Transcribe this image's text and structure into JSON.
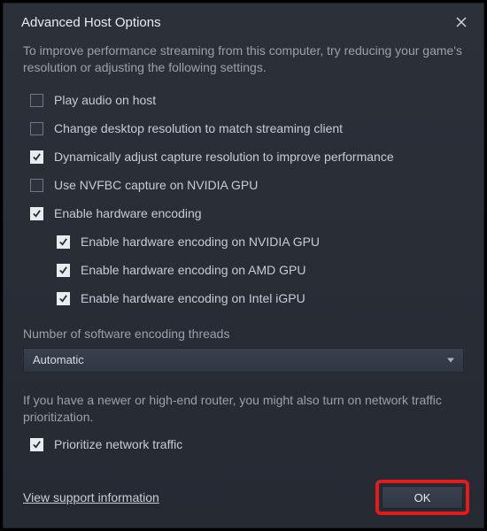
{
  "window": {
    "title": "Advanced Host Options"
  },
  "intro": "To improve performance streaming from this computer, try reducing your game's resolution or adjusting the following settings.",
  "options": {
    "play_audio": {
      "label": "Play audio on host",
      "checked": false
    },
    "change_resolution": {
      "label": "Change desktop resolution to match streaming client",
      "checked": false
    },
    "dynamic_capture": {
      "label": "Dynamically adjust capture resolution to improve performance",
      "checked": true
    },
    "nvfbc": {
      "label": "Use NVFBC capture on NVIDIA GPU",
      "checked": false
    },
    "hw_encoding": {
      "label": "Enable hardware encoding",
      "checked": true
    },
    "hw_nvidia": {
      "label": "Enable hardware encoding on NVIDIA GPU",
      "checked": true
    },
    "hw_amd": {
      "label": "Enable hardware encoding on AMD GPU",
      "checked": true
    },
    "hw_intel": {
      "label": "Enable hardware encoding on Intel iGPU",
      "checked": true
    },
    "prioritize": {
      "label": "Prioritize network traffic",
      "checked": true
    }
  },
  "threads": {
    "label": "Number of software encoding threads",
    "value": "Automatic"
  },
  "router_note": "If you have a newer or high-end router, you might also turn on network traffic prioritization.",
  "footer": {
    "support_link": "View support information",
    "ok_label": "OK"
  }
}
